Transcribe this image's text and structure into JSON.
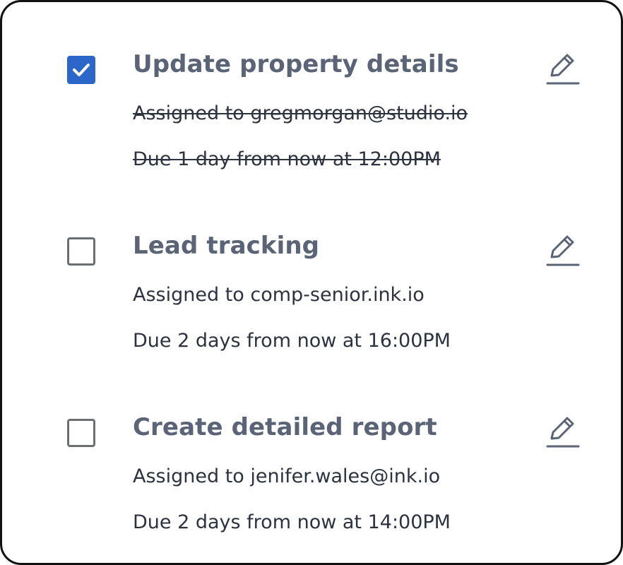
{
  "tasks": [
    {
      "title": "Update property details",
      "assignee": "Assigned to gregmorgan@studio.io",
      "due": "Due 1 day from now at 12:00PM",
      "completed": true,
      "check_icon": "checkmark-icon",
      "edit_icon": "pencil-icon"
    },
    {
      "title": "Lead tracking",
      "assignee": "Assigned to comp-senior.ink.io",
      "due": "Due 2 days from now at 16:00PM",
      "completed": false,
      "edit_icon": "pencil-icon"
    },
    {
      "title": "Create detailed report",
      "assignee": "Assigned to jenifer.wales@ink.io",
      "due": "Due 2 days from now at 14:00PM",
      "completed": false,
      "edit_icon": "pencil-icon"
    }
  ],
  "colors": {
    "checkbox_checked": "#2d66c9",
    "checkbox_unchecked_border": "#6b6e72",
    "title_text": "#5a6476",
    "body_text": "#2c3240",
    "edit_icon": "#5a6476"
  }
}
